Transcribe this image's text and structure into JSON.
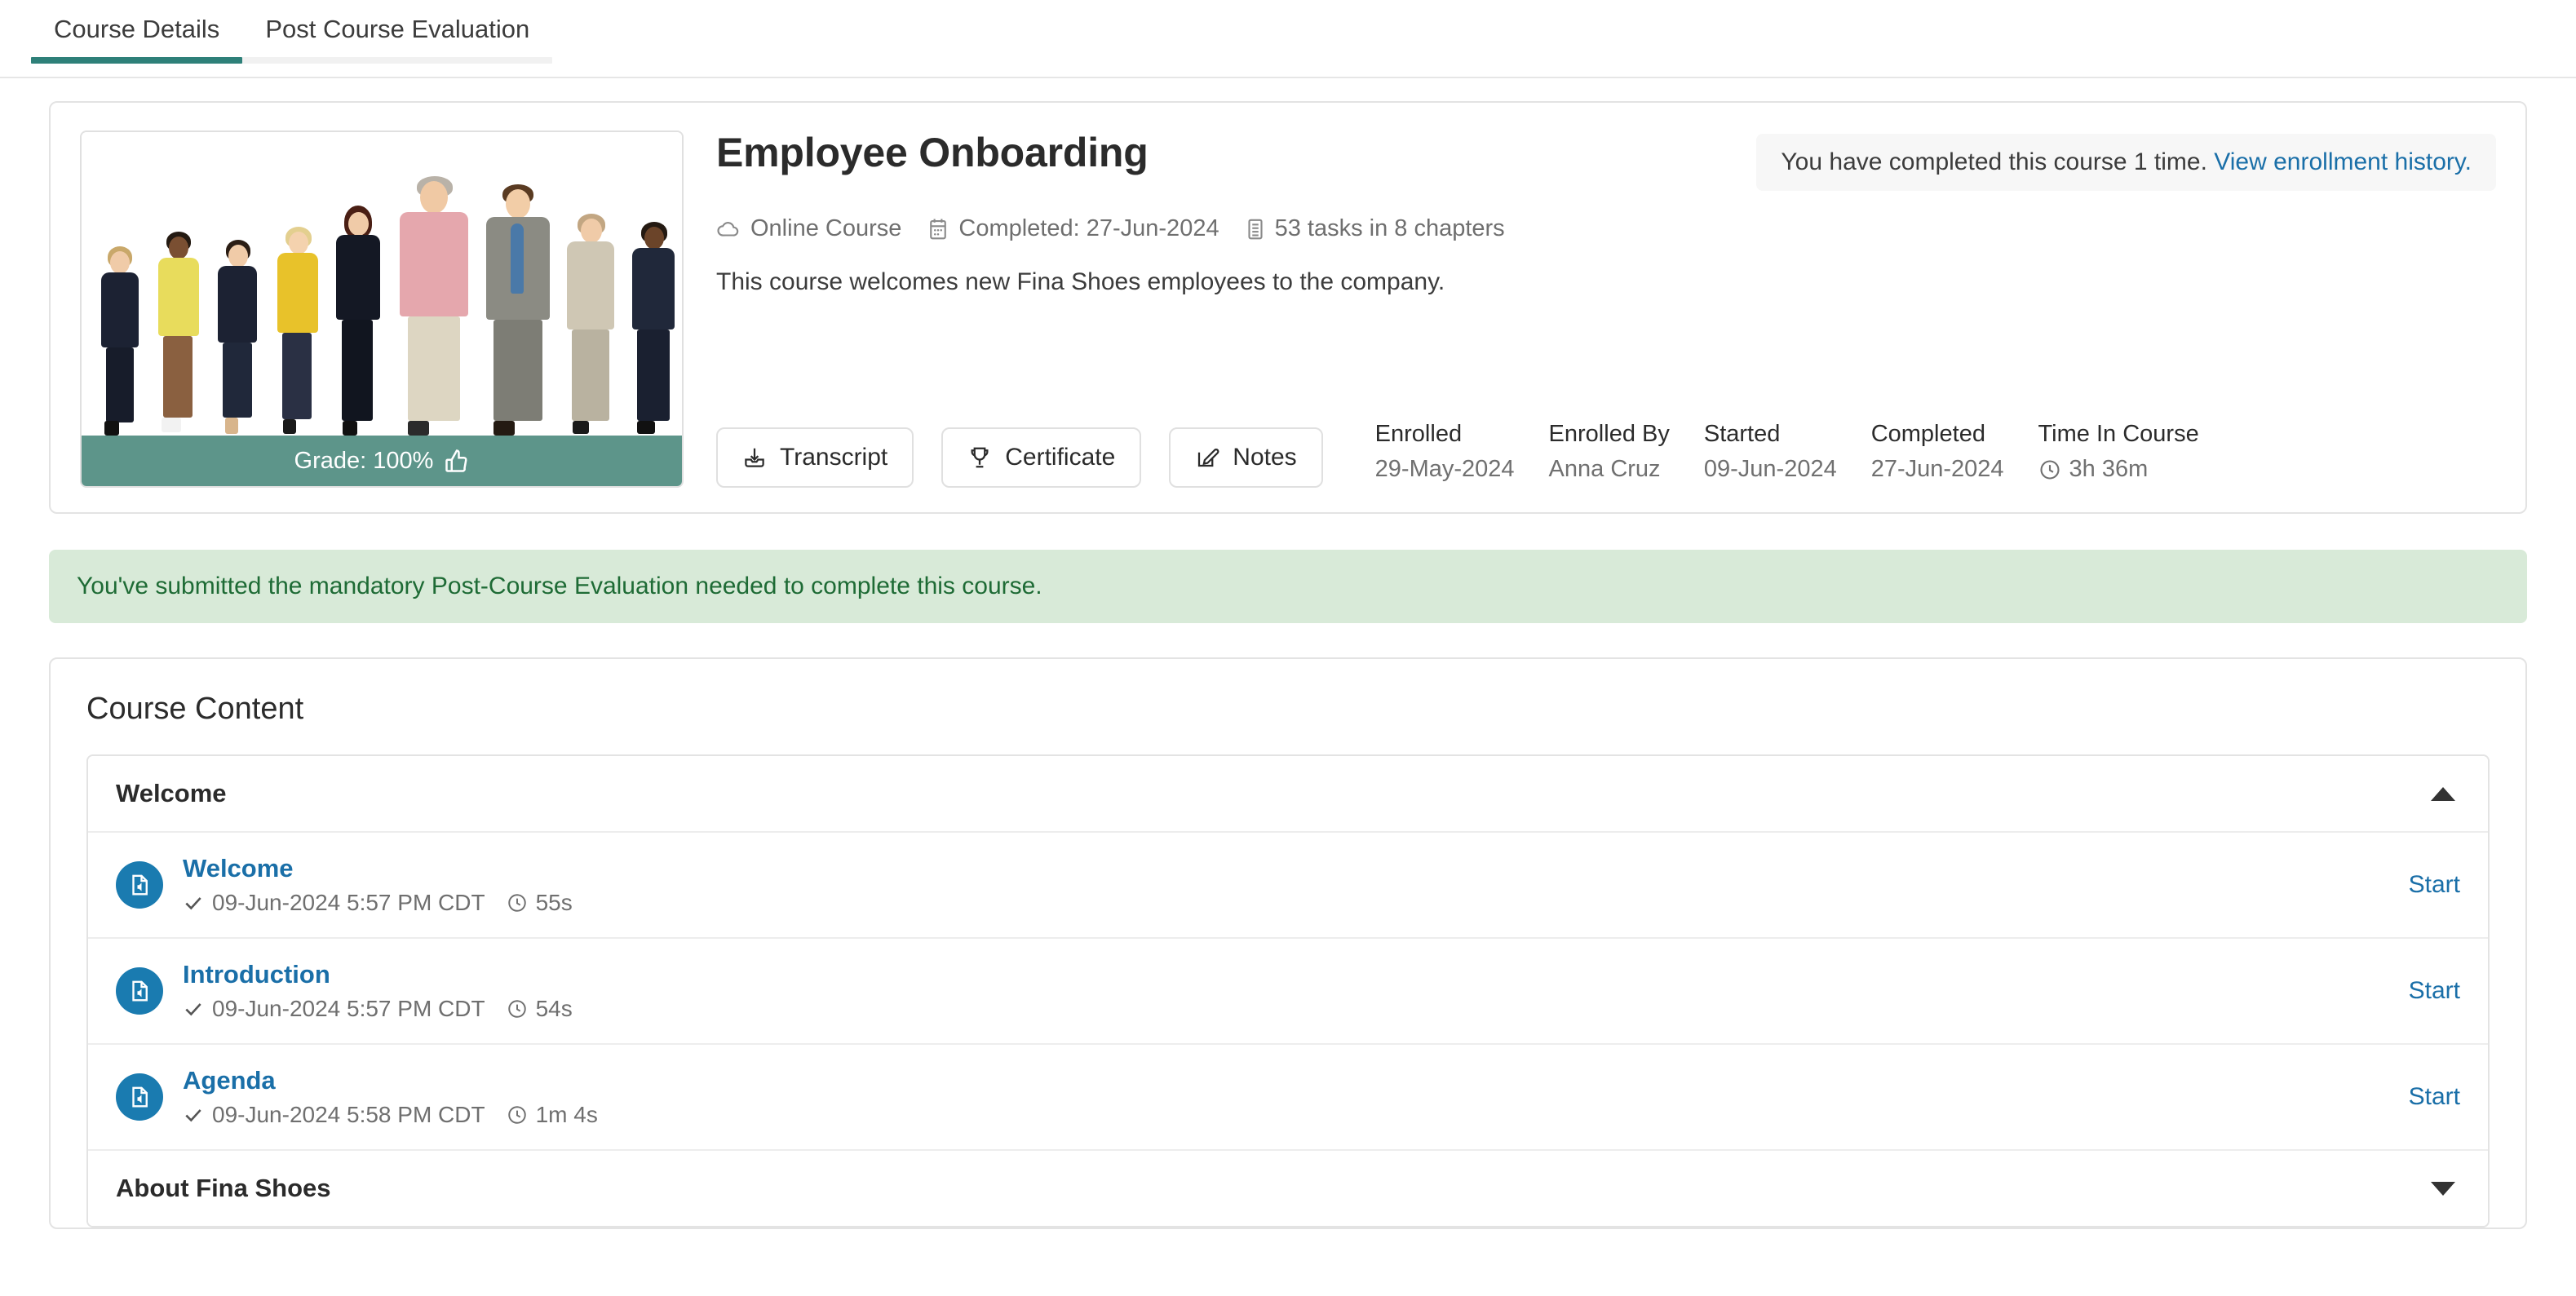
{
  "tabs": [
    {
      "label": "Course Details",
      "active": true
    },
    {
      "label": "Post Course Evaluation",
      "active": false
    }
  ],
  "course": {
    "title": "Employee Onboarding",
    "description": "This course welcomes new Fina Shoes employees to the company.",
    "grade_label": "Grade: 100%",
    "meta": [
      {
        "icon": "cloud-icon",
        "text": "Online Course"
      },
      {
        "icon": "calendar-icon",
        "text": "Completed: 27-Jun-2024"
      },
      {
        "icon": "list-icon",
        "text": "53 tasks in 8 chapters"
      }
    ],
    "enrollment_note": {
      "text": "You have completed this course 1 time.",
      "link": "View enrollment history."
    },
    "buttons": [
      {
        "icon": "transcript-icon",
        "label": "Transcript"
      },
      {
        "icon": "trophy-icon",
        "label": "Certificate"
      },
      {
        "icon": "notes-icon",
        "label": "Notes"
      }
    ],
    "stats": [
      {
        "label": "Enrolled",
        "value": "29-May-2024"
      },
      {
        "label": "Enrolled By",
        "value": "Anna Cruz"
      },
      {
        "label": "Started",
        "value": "09-Jun-2024"
      },
      {
        "label": "Completed",
        "value": "27-Jun-2024"
      },
      {
        "label": "Time In Course",
        "value": "3h 36m",
        "icon": "clock-icon"
      }
    ]
  },
  "alert": {
    "text": "You've submitted the mandatory Post-Course Evaluation needed to complete this course."
  },
  "content": {
    "heading": "Course Content",
    "chapters": [
      {
        "title": "Welcome",
        "expanded": true,
        "lessons": [
          {
            "name": "Welcome",
            "date": "09-Jun-2024 5:57 PM CDT",
            "duration": "55s",
            "action": "Start"
          },
          {
            "name": "Introduction",
            "date": "09-Jun-2024 5:57 PM CDT",
            "duration": "54s",
            "action": "Start"
          },
          {
            "name": "Agenda",
            "date": "09-Jun-2024 5:58 PM CDT",
            "duration": "1m 4s",
            "action": "Start"
          }
        ]
      },
      {
        "title": "About Fina Shoes",
        "expanded": false,
        "lessons": []
      }
    ]
  },
  "colors": {
    "accent_teal": "#2e8079",
    "grade_bar": "#5d958a",
    "link_blue": "#1a6fa8",
    "lesson_icon_blue": "#1a7bb0",
    "alert_bg": "#d8ead8",
    "alert_text": "#1e6b35"
  }
}
